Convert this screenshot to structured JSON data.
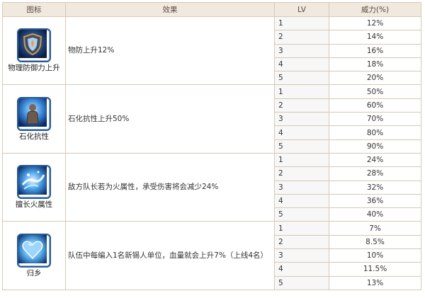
{
  "header": {
    "icon": "图标",
    "effect": "效果",
    "lv": "LV",
    "power": "威力(%)"
  },
  "skills": [
    {
      "name": "物理防御力上升",
      "icon": "shield-icon",
      "effect": "物防上升12%",
      "levels": [
        {
          "lv": "1",
          "power": "12%"
        },
        {
          "lv": "2",
          "power": "14%"
        },
        {
          "lv": "3",
          "power": "16%"
        },
        {
          "lv": "4",
          "power": "18%"
        },
        {
          "lv": "5",
          "power": "20%"
        }
      ]
    },
    {
      "name": "石化抗性",
      "icon": "stone-figure-icon",
      "effect": "石化抗性上升50%",
      "levels": [
        {
          "lv": "1",
          "power": "50%"
        },
        {
          "lv": "2",
          "power": "60%"
        },
        {
          "lv": "3",
          "power": "70%"
        },
        {
          "lv": "4",
          "power": "80%"
        },
        {
          "lv": "5",
          "power": "90%"
        }
      ]
    },
    {
      "name": "擅长火属性",
      "icon": "splash-icon",
      "effect": "敌方队长若为火属性，承受伤害将会减少24%",
      "levels": [
        {
          "lv": "1",
          "power": "24%"
        },
        {
          "lv": "2",
          "power": "28%"
        },
        {
          "lv": "3",
          "power": "32%"
        },
        {
          "lv": "4",
          "power": "36%"
        },
        {
          "lv": "5",
          "power": "40%"
        }
      ]
    },
    {
      "name": "归乡",
      "icon": "heart-icon",
      "effect": "队伍中每编入1名新锡人单位，血量就会上升7%（上线4名）",
      "levels": [
        {
          "lv": "1",
          "power": "7%"
        },
        {
          "lv": "2",
          "power": "8.5%"
        },
        {
          "lv": "3",
          "power": "10%"
        },
        {
          "lv": "4",
          "power": "11.5%"
        },
        {
          "lv": "5",
          "power": "13%"
        }
      ]
    }
  ]
}
